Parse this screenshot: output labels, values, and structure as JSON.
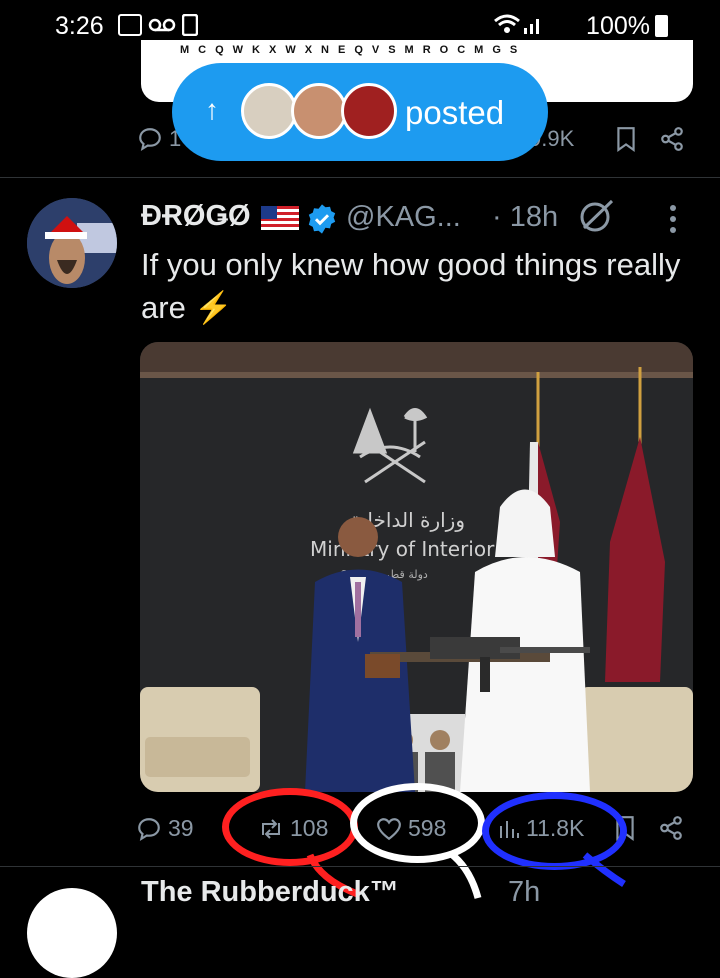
{
  "status_bar": {
    "time": "3:26",
    "battery": "100%"
  },
  "prev_tweet": {
    "card_letters": "MCQWKXWXNEQVSMROCMGS",
    "reply_count": "1",
    "views": "9.9K"
  },
  "posted_pill": {
    "label": "posted",
    "arrow": "↑"
  },
  "tweet": {
    "display_name": "ĐɌØǤØ",
    "handle": "@KAG...",
    "time": "· 18h",
    "text": "If you only knew how good things really are ⚡",
    "image_caption_en": "Ministry of Interior",
    "image_caption_ar": "وزارة الداخلية",
    "image_caption_small": "Qatar • دولة قطر",
    "actions": {
      "replies": "39",
      "reposts": "108",
      "likes": "598",
      "views": "11.8K"
    }
  },
  "next_tweet": {
    "display_name": "The Rubberduck™",
    "time": "7h"
  },
  "colors": {
    "accent": "#1d9bf0",
    "bg": "#000000",
    "muted": "#8b98a5",
    "annot_red": "#ff2020",
    "annot_white": "#ffffff",
    "annot_blue": "#2030ff"
  }
}
